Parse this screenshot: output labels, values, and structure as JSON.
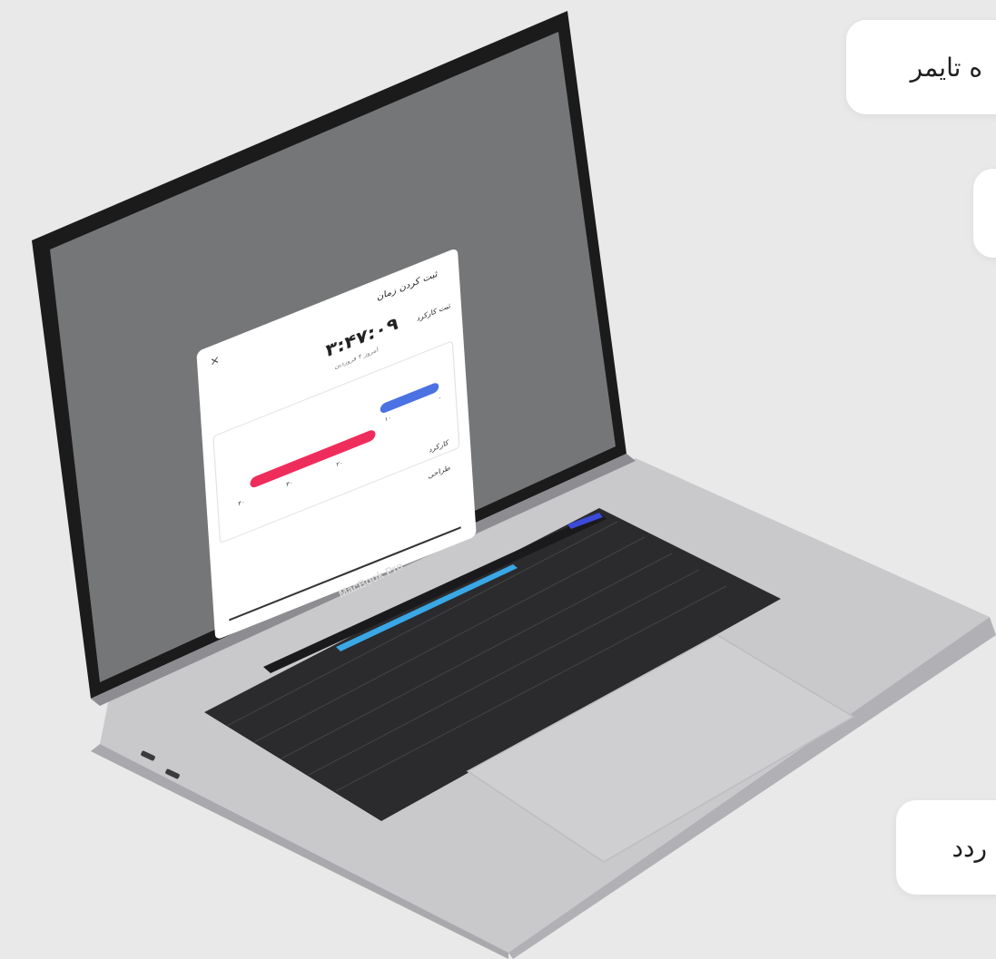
{
  "callouts": [
    {
      "text": "ه تایمر"
    },
    {
      "text": ""
    },
    {
      "text": "ردد"
    }
  ],
  "laptop": {
    "brand": "MacBook Pro"
  },
  "modal": {
    "title": "ثبت کردن زمان",
    "time": "۳:۴۷:۰۹",
    "subtitle": "امروز ۴ فروردین",
    "tab_label": "ثبت کارکرد",
    "axis_labels": [
      "۰",
      "۱۰",
      "۲۰",
      "۳۰",
      "۴۰"
    ],
    "labels": [
      "کارکرد",
      "طراحی"
    ],
    "close_label": "×"
  }
}
